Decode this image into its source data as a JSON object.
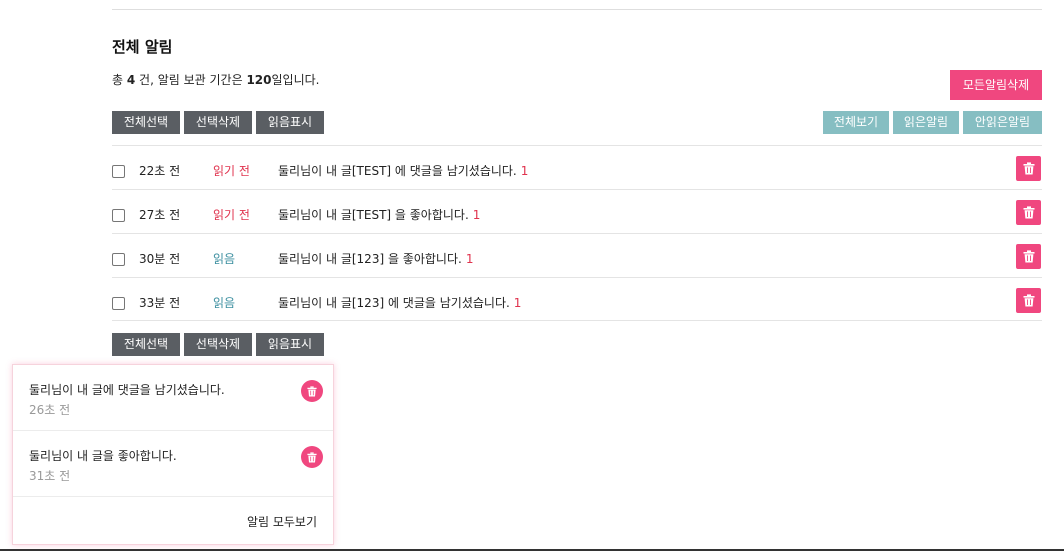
{
  "page": {
    "title": "전체 알림",
    "summary": {
      "prefix": "총 ",
      "count": "4",
      "middle": " 건, 알림 보관 기간은 ",
      "days": "120",
      "suffix": "일입니다."
    }
  },
  "actions": {
    "delete_all": "모든알림삭제",
    "select_all": "전체선택",
    "delete_selected": "선택삭제",
    "mark_read": "읽음표시"
  },
  "filters": {
    "all": "전체보기",
    "read": "읽은알림",
    "unread": "안읽은알림"
  },
  "notifications": [
    {
      "time": "22초 전",
      "status": "읽기 전",
      "read": false,
      "message": "둘리님이 내 글[TEST] 에 댓글을 남기셨습니다.",
      "count": "1"
    },
    {
      "time": "27초 전",
      "status": "읽기 전",
      "read": false,
      "message": "둘리님이 내 글[TEST] 을 좋아합니다.",
      "count": "1"
    },
    {
      "time": "30분 전",
      "status": "읽음",
      "read": true,
      "message": "둘리님이 내 글[123] 을 좋아합니다.",
      "count": "1"
    },
    {
      "time": "33분 전",
      "status": "읽음",
      "read": true,
      "message": "둘리님이 내 글[123] 에 댓글을 남기셨습니다.",
      "count": "1"
    }
  ],
  "popup": {
    "items": [
      {
        "message": "둘리님이 내 글에 댓글을 남기셨습니다.",
        "time": "26초 전"
      },
      {
        "message": "둘리님이 내 글을 좋아합니다.",
        "time": "31초 전"
      }
    ],
    "view_all": "알림 모두보기"
  },
  "colors": {
    "accent_pink": "#f0477f",
    "teal": "#86bec2",
    "dark_button": "#5a5e63",
    "unread_text": "#e0334e",
    "read_text": "#3c8fa0"
  },
  "icons": {
    "delete": "trash-icon"
  }
}
